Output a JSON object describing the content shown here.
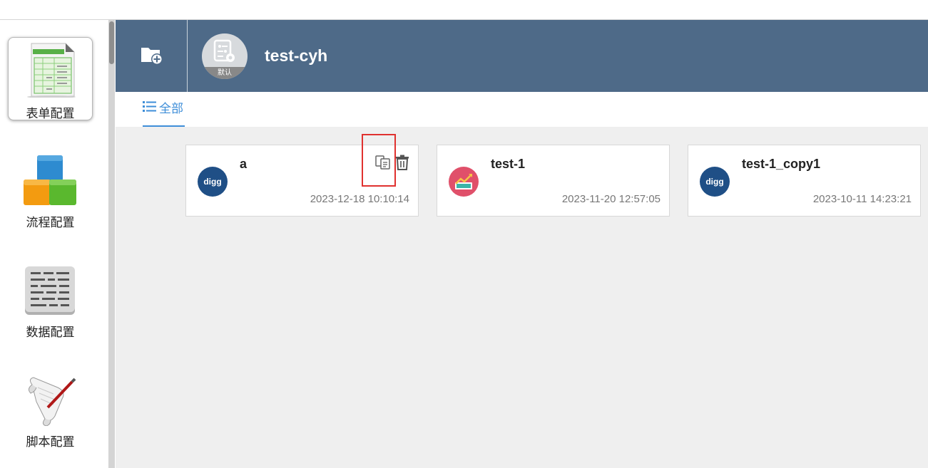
{
  "sidebar": {
    "items": [
      {
        "label": "表单配置",
        "icon": "form-config-icon",
        "active": true
      },
      {
        "label": "流程配置",
        "icon": "flow-config-icon",
        "active": false
      },
      {
        "label": "数据配置",
        "icon": "data-config-icon",
        "active": false
      },
      {
        "label": "脚本配置",
        "icon": "script-config-icon",
        "active": false
      }
    ]
  },
  "header": {
    "add_icon": "add-folder-icon",
    "app_avatar_tag": "默认",
    "app_title": "test-cyh",
    "background_color": "#4e6a88"
  },
  "tabs": [
    {
      "label": "全部",
      "icon": "list-icon",
      "active": true
    }
  ],
  "cards": [
    {
      "name": "a",
      "time": "2023-12-18 10:10:14",
      "logo": "digg",
      "logo_text": "digg",
      "show_actions": true
    },
    {
      "name": "test-1",
      "time": "2023-11-20 12:57:05",
      "logo": "chart",
      "logo_text": "",
      "show_actions": false
    },
    {
      "name": "test-1_copy1",
      "time": "2023-10-11 14:23:21",
      "logo": "digg",
      "logo_text": "digg",
      "show_actions": false
    }
  ],
  "colors": {
    "accent": "#3e8ed8",
    "highlight": "#e0312f",
    "digg_logo": "#1f4f86",
    "chart_logo": "#e0506a"
  }
}
